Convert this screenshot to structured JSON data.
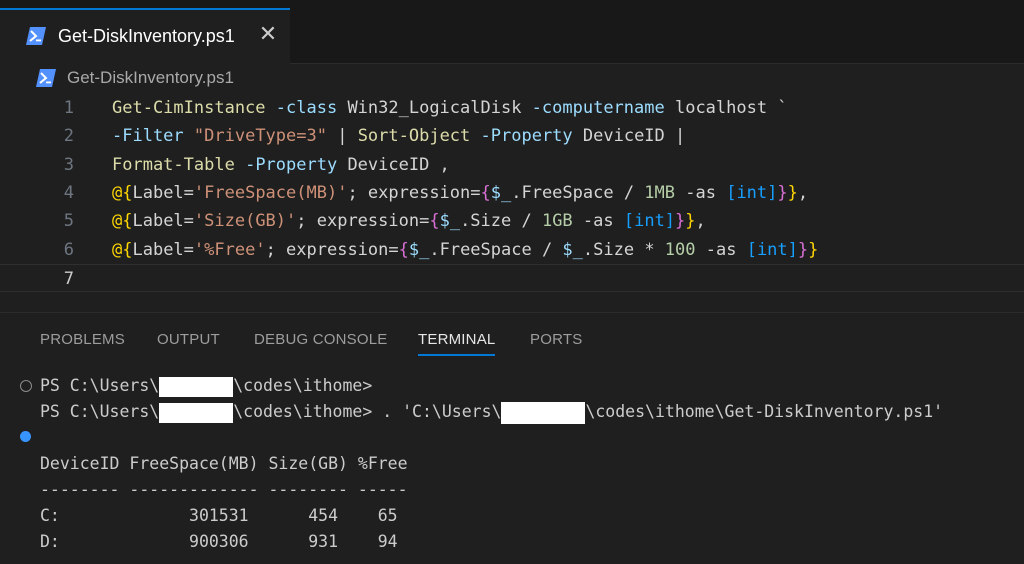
{
  "tab": {
    "label": "Get-DiskInventory.ps1",
    "close_glyph": "✕",
    "icon": "powershell-icon"
  },
  "breadcrumb": {
    "label": "Get-DiskInventory.ps1",
    "icon": "powershell-icon"
  },
  "editor": {
    "line_numbers": [
      "1",
      "2",
      "3",
      "4",
      "5",
      "6",
      "7"
    ],
    "lines": [
      {
        "tokens": [
          [
            "cmd",
            "Get-CimInstance"
          ],
          [
            "plain",
            " "
          ],
          [
            "param",
            "-class"
          ],
          [
            "plain",
            " Win32_LogicalDisk "
          ],
          [
            "param",
            "-computername"
          ],
          [
            "plain",
            " localhost `"
          ]
        ]
      },
      {
        "tokens": [
          [
            "param",
            "-Filter"
          ],
          [
            "plain",
            " "
          ],
          [
            "str",
            "\"DriveType=3\""
          ],
          [
            "plain",
            " | "
          ],
          [
            "cmd",
            "Sort-Object"
          ],
          [
            "plain",
            " "
          ],
          [
            "param",
            "-Property"
          ],
          [
            "plain",
            " DeviceID |"
          ]
        ]
      },
      {
        "tokens": [
          [
            "cmd",
            "Format-Table"
          ],
          [
            "plain",
            " "
          ],
          [
            "param",
            "-Property"
          ],
          [
            "plain",
            " DeviceID ,"
          ]
        ]
      },
      {
        "tokens": [
          [
            "b1",
            "@{"
          ],
          [
            "plain",
            "Label="
          ],
          [
            "str",
            "'FreeSpace(MB)'"
          ],
          [
            "plain",
            "; expression="
          ],
          [
            "b2",
            "{"
          ],
          [
            "var",
            "$_"
          ],
          [
            "plain",
            ".FreeSpace / "
          ],
          [
            "num",
            "1MB"
          ],
          [
            "plain",
            " -as "
          ],
          [
            "b3",
            "[int]"
          ],
          [
            "b2",
            "}"
          ],
          [
            "b1",
            "}"
          ],
          [
            "plain",
            ","
          ]
        ]
      },
      {
        "tokens": [
          [
            "b1",
            "@{"
          ],
          [
            "plain",
            "Label="
          ],
          [
            "str",
            "'Size(GB)'"
          ],
          [
            "plain",
            "; expression="
          ],
          [
            "b2",
            "{"
          ],
          [
            "var",
            "$_"
          ],
          [
            "plain",
            ".Size / "
          ],
          [
            "num",
            "1GB"
          ],
          [
            "plain",
            " -as "
          ],
          [
            "b3",
            "[int]"
          ],
          [
            "b2",
            "}"
          ],
          [
            "b1",
            "}"
          ],
          [
            "plain",
            ","
          ]
        ]
      },
      {
        "tokens": [
          [
            "b1",
            "@{"
          ],
          [
            "plain",
            "Label="
          ],
          [
            "str",
            "'%Free'"
          ],
          [
            "plain",
            "; expression="
          ],
          [
            "b2",
            "{"
          ],
          [
            "var",
            "$_"
          ],
          [
            "plain",
            ".FreeSpace / "
          ],
          [
            "var",
            "$_"
          ],
          [
            "plain",
            ".Size * "
          ],
          [
            "num",
            "100"
          ],
          [
            "plain",
            " -as "
          ],
          [
            "b3",
            "[int]"
          ],
          [
            "b2",
            "}"
          ],
          [
            "b1",
            "}"
          ]
        ]
      },
      {
        "tokens": []
      }
    ]
  },
  "panel": {
    "tabs": [
      "PROBLEMS",
      "OUTPUT",
      "DEBUG CONSOLE",
      "TERMINAL",
      "PORTS"
    ],
    "active_tab": "TERMINAL"
  },
  "terminal": {
    "prompt1_a": "PS C:\\Users\\",
    "prompt1_b": "\\codes\\ithome>",
    "prompt2_a": "PS C:\\Users\\",
    "prompt2_b": "\\codes\\ithome> . 'C:\\Users\\",
    "prompt2_c": "\\codes\\ithome\\Get-DiskInventory.ps1'",
    "header": "DeviceID FreeSpace(MB) Size(GB) %Free",
    "divider": "-------- ------------- -------- -----",
    "rows": [
      "C:             301531      454    65",
      "D:             900306      931    94"
    ]
  },
  "colors": {
    "accent": "#0078d4",
    "terminal_dot": "#3794ff"
  }
}
